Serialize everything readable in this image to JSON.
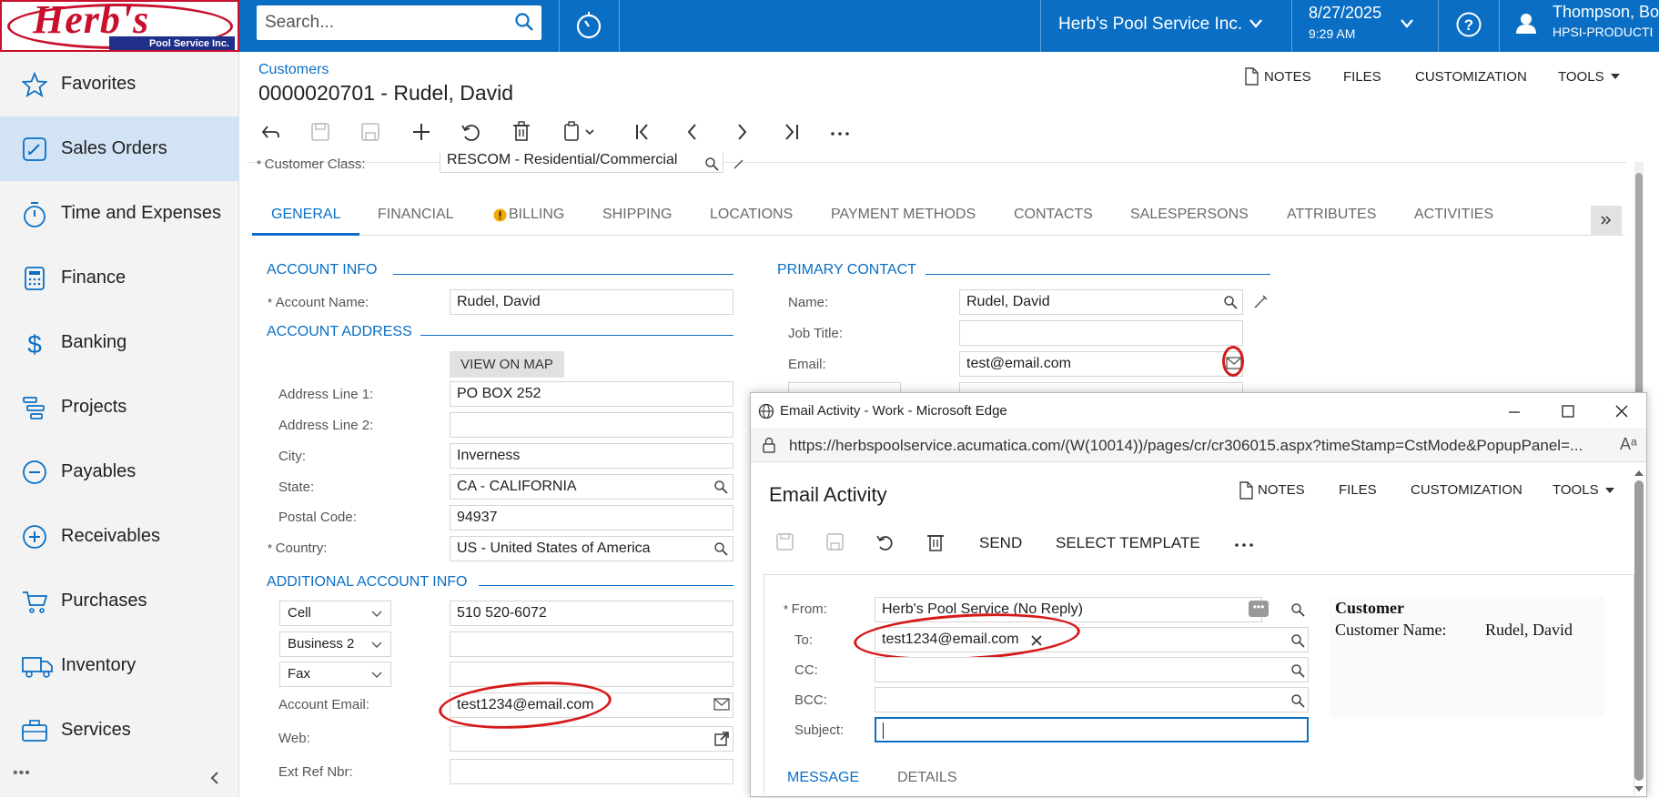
{
  "header": {
    "logo_text": "Herb's",
    "logo_sub": "Pool Service Inc.",
    "search_placeholder": "Search...",
    "company": "Herb's Pool Service Inc.",
    "date": "8/27/2025",
    "time": "9:29 AM",
    "user_name": "Thompson, Bo",
    "user_tenant": "HPSI-PRODUCTI"
  },
  "sidebar": {
    "items": [
      {
        "label": "Favorites",
        "icon": "star-icon"
      },
      {
        "label": "Sales Orders",
        "icon": "pencil-square-icon"
      },
      {
        "label": "Time and Expenses",
        "icon": "stopwatch-icon"
      },
      {
        "label": "Finance",
        "icon": "calculator-icon"
      },
      {
        "label": "Banking",
        "icon": "dollar-icon"
      },
      {
        "label": "Projects",
        "icon": "projects-icon"
      },
      {
        "label": "Payables",
        "icon": "minus-circle-icon"
      },
      {
        "label": "Receivables",
        "icon": "plus-circle-icon"
      },
      {
        "label": "Purchases",
        "icon": "cart-icon"
      },
      {
        "label": "Inventory",
        "icon": "truck-icon"
      },
      {
        "label": "Services",
        "icon": "briefcase-icon"
      }
    ],
    "more": "•••"
  },
  "page": {
    "breadcrumb": "Customers",
    "title": "0000020701 - Rudel, David",
    "actions": {
      "notes": "NOTES",
      "files": "FILES",
      "customization": "CUSTOMIZATION",
      "tools": "TOOLS"
    },
    "customer_class_label": "Customer Class:",
    "customer_class_value": "RESCOM - Residential/Commercial"
  },
  "tabs": [
    "GENERAL",
    "FINANCIAL",
    "BILLING",
    "SHIPPING",
    "LOCATIONS",
    "PAYMENT METHODS",
    "CONTACTS",
    "SALESPERSONS",
    "ATTRIBUTES",
    "ACTIVITIES"
  ],
  "account": {
    "section_info": "ACCOUNT INFO",
    "name_label": "Account Name:",
    "name_value": "Rudel, David",
    "section_address": "ACCOUNT ADDRESS",
    "view_on_map": "VIEW ON MAP",
    "addr1_label": "Address Line 1:",
    "addr1_value": "PO BOX 252",
    "addr2_label": "Address Line 2:",
    "addr2_value": "",
    "city_label": "City:",
    "city_value": "Inverness",
    "state_label": "State:",
    "state_value": "CA - CALIFORNIA",
    "postal_label": "Postal Code:",
    "postal_value": "94937",
    "country_label": "Country:",
    "country_value": "US - United States of America",
    "section_additional": "ADDITIONAL ACCOUNT INFO",
    "phone1_type": "Cell",
    "phone1_value": "510 520-6072",
    "phone2_type": "Business 2",
    "phone2_value": "",
    "fax_type": "Fax",
    "fax_value": "",
    "email_label": "Account Email:",
    "email_value": "test1234@email.com",
    "web_label": "Web:",
    "web_value": "",
    "extref_label": "Ext Ref Nbr:",
    "extref_value": ""
  },
  "contact": {
    "section": "PRIMARY CONTACT",
    "name_label": "Name:",
    "name_value": "Rudel, David",
    "job_label": "Job Title:",
    "job_value": "",
    "email_label": "Email:",
    "email_value": "test@email.com"
  },
  "popup": {
    "window_title": "Email Activity - Work - Microsoft Edge",
    "url": "https://herbspoolservice.acumatica.com/(W(10014))/pages/cr/cr306015.aspx?timeStamp=CstMode&PopupPanel=...",
    "title": "Email Activity",
    "actions": {
      "notes": "NOTES",
      "files": "FILES",
      "customization": "CUSTOMIZATION",
      "tools": "TOOLS"
    },
    "send": "SEND",
    "select_template": "SELECT TEMPLATE",
    "from_label": "From:",
    "from_value": "Herb's Pool Service (No Reply)",
    "to_label": "To:",
    "to_value": "test1234@email.com",
    "cc_label": "CC:",
    "bcc_label": "BCC:",
    "subject_label": "Subject:",
    "subject_value": "",
    "info_heading": "Customer",
    "info_label": "Customer Name:",
    "info_value": "Rudel, David",
    "tab_message": "MESSAGE",
    "tab_details": "DETAILS"
  },
  "colors": {
    "brand_blue": "#0a6fc4",
    "annotation_red": "#d61a1a",
    "logo_red": "#c8102e"
  }
}
